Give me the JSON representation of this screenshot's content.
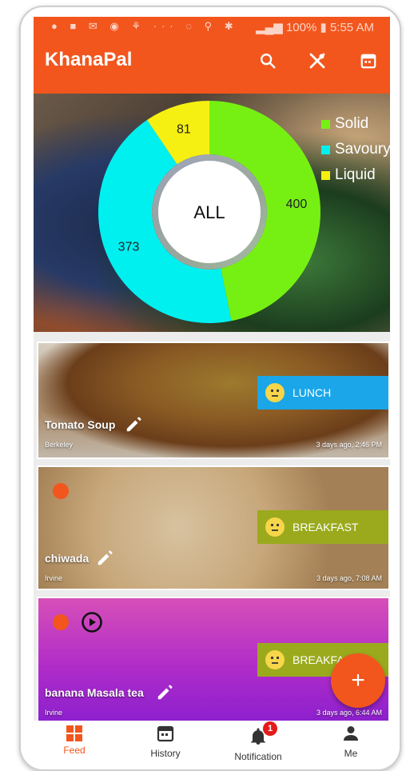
{
  "status_bar": {
    "battery": "100%",
    "time": "5:55 AM"
  },
  "app_bar": {
    "title": "KhanaPal",
    "icons": [
      "search-icon",
      "utensils-icon",
      "calendar-icon"
    ]
  },
  "colors": {
    "primary": "#f2561d",
    "solid": "#76f013",
    "savoury": "#00f0f0",
    "liquid": "#f6f012",
    "lunch_ribbon": "#1aa6e8",
    "breakfast_ribbon": "#9aaa1c"
  },
  "chart_data": {
    "type": "pie",
    "center_label": "ALL",
    "categories": [
      "Solid",
      "Savoury",
      "Liquid"
    ],
    "values": [
      400,
      373,
      81
    ],
    "legend": [
      "Solid",
      "Savoury",
      "Liquid"
    ],
    "legend_position": "top-right"
  },
  "feed": [
    {
      "name": "Tomato Soup",
      "location": "Berkeley",
      "time": "3 days ago, 2:46 PM",
      "meal": "LUNCH"
    },
    {
      "name": "chiwada",
      "location": "Irvine",
      "time": "3 days ago, 7:08 AM",
      "meal": "BREAKFAST"
    },
    {
      "name": "banana Masala tea",
      "location": "Irvine",
      "time": "3 days ago, 6:44 AM",
      "meal": "BREAKFAST"
    }
  ],
  "fab": {
    "label": "+"
  },
  "bottom_nav": [
    {
      "label": "Feed",
      "icon": "grid-icon"
    },
    {
      "label": "History",
      "icon": "calendar-icon"
    },
    {
      "label": "Notification",
      "icon": "bell-icon",
      "badge": "1"
    },
    {
      "label": "Me",
      "icon": "person-icon"
    }
  ]
}
